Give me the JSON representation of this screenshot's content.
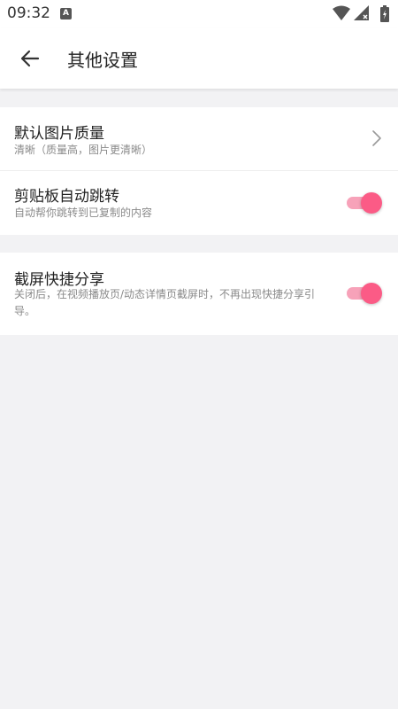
{
  "status_bar": {
    "time": "09:32",
    "notification_icon": "a-letter-icon",
    "icons": [
      "wifi-icon",
      "signal-icon",
      "battery-icon"
    ]
  },
  "header": {
    "back_icon": "arrow-left-icon",
    "title": "其他设置"
  },
  "settings": {
    "image_quality": {
      "title": "默认图片质量",
      "subtitle": "清晰（质量高，图片更清晰）",
      "icon": "chevron-right-icon"
    },
    "clipboard_jump": {
      "title": "剪贴板自动跳转",
      "subtitle": "自动帮你跳转到已复制的内容",
      "enabled": true
    },
    "screenshot_share": {
      "title": "截屏快捷分享",
      "subtitle": "关闭后，在视频播放页/动态详情页截屏时，不再出现快捷分享引导。",
      "enabled": true
    }
  },
  "colors": {
    "accent": "#fb5b86",
    "accent_track": "#f7a2b9",
    "background": "#f2f2f4"
  }
}
